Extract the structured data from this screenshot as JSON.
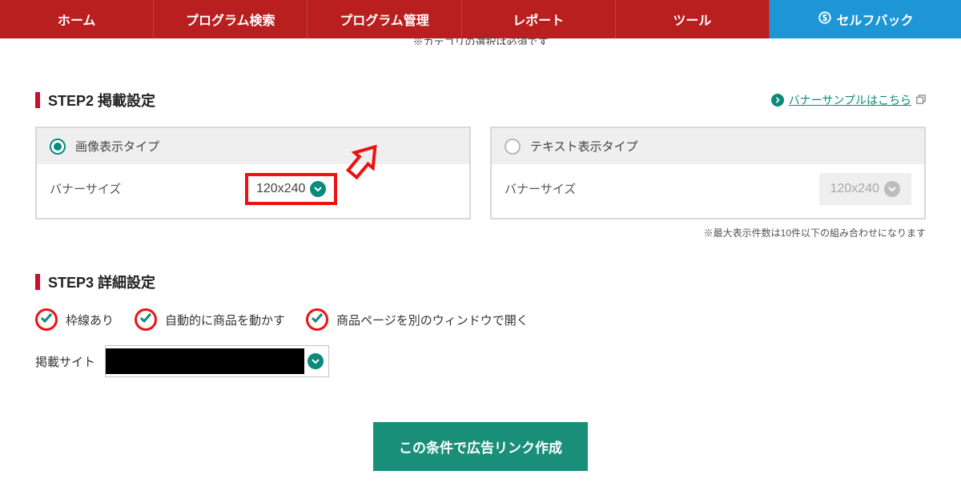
{
  "nav": {
    "items": [
      {
        "label": "ホーム"
      },
      {
        "label": "プログラム検索"
      },
      {
        "label": "プログラム管理"
      },
      {
        "label": "レポート"
      },
      {
        "label": "ツール"
      },
      {
        "label": "セルフバック"
      }
    ]
  },
  "cutoff_text": "※カテゴリの選択は必須です",
  "step2": {
    "title": "STEP2 掲載設定",
    "banner_sample_label": "バナーサンプルはこちら",
    "panel_image": {
      "radio_label": "画像表示タイプ",
      "body_label": "バナーサイズ",
      "size_value": "120x240"
    },
    "panel_text": {
      "radio_label": "テキスト表示タイプ",
      "body_label": "バナーサイズ",
      "size_value": "120x240"
    },
    "note": "※最大表示件数は10件以下の組み合わせになります"
  },
  "step3": {
    "title": "STEP3 詳細設定",
    "checks": [
      {
        "label": "枠線あり"
      },
      {
        "label": "自動的に商品を動かす"
      },
      {
        "label": "商品ページを別のウィンドウで開く"
      }
    ],
    "site_label": "掲載サイト"
  },
  "action_button": "この条件で広告リンク作成"
}
